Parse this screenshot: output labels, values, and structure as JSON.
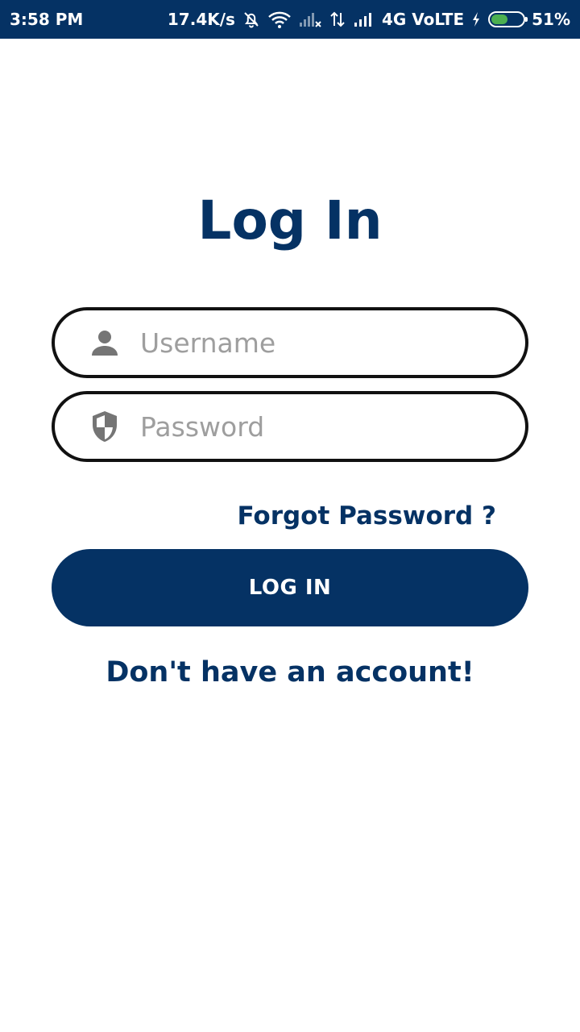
{
  "status_bar": {
    "time": "3:58 PM",
    "net_speed": "17.4K/s",
    "network": "4G VoLTE",
    "battery": "51%",
    "battery_level": 0.51,
    "icons": [
      "bell-off-icon",
      "wifi-icon",
      "signal-x-icon",
      "data-arrows-icon",
      "signal-icon",
      "charging-icon",
      "battery-icon"
    ]
  },
  "title": "Log In",
  "username": {
    "icon": "person-icon",
    "placeholder": "Username",
    "value": ""
  },
  "password": {
    "icon": "shield-icon",
    "placeholder": "Password",
    "value": ""
  },
  "forgot_password": "Forgot Password ?",
  "login_button": "LOG IN",
  "signup_link": "Don't have an account!",
  "colors": {
    "primary": "#053264",
    "placeholder": "#9e9e9e",
    "icon_gray": "#757575",
    "battery_green": "#4caf50"
  }
}
